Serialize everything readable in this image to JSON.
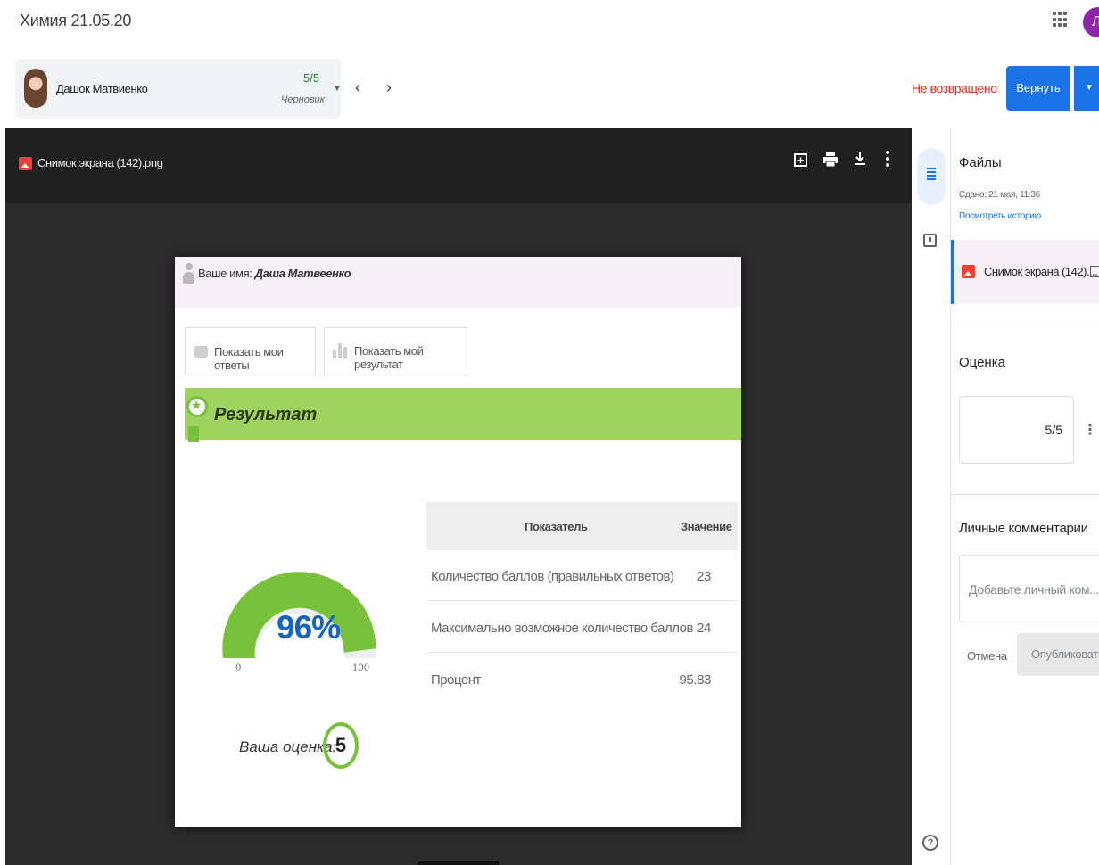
{
  "page": {
    "title": "Химия 21.05.20",
    "account_initial": "Л"
  },
  "student": {
    "name": "Дашок Матвиенко",
    "grade": "5/5",
    "status": "Черновик"
  },
  "actions": {
    "return_status": "Не возвращено",
    "return_label": "Вернуть"
  },
  "viewer": {
    "file_title": "Снимок экрана (142).png"
  },
  "screenshot": {
    "name_label": "Ваше имя:",
    "name_value": "Даша Матвеенко",
    "show_answers": "Показать мои ответы",
    "show_result": "Показать мой результат",
    "result_title": "Результат",
    "gauge": {
      "value": 96,
      "display": "96%",
      "min": "0",
      "max": "100",
      "color": "#78c13a"
    },
    "grade_label": "Ваша оценка:",
    "grade_value": "5",
    "table": {
      "headers": [
        "Показатель",
        "Значение"
      ],
      "rows": [
        {
          "label": "Количество баллов (правильных ответов)",
          "value": "23"
        },
        {
          "label": "Максимально возможное количество баллов",
          "value": "24"
        },
        {
          "label": "Процент",
          "value": "95.83"
        }
      ]
    }
  },
  "panel": {
    "files_title": "Файлы",
    "submitted": "Сдано: 21 мая, 11:36",
    "history_link": "Посмотреть историю",
    "attachment": "Снимок экрана (142)....",
    "grade_title": "Оценка",
    "grade_value": "5/5",
    "comments_title": "Личные комментарии",
    "comment_placeholder": "Добавьте личный ком...",
    "cancel": "Отмена",
    "publish": "Опубликовать"
  },
  "colors": {
    "accent": "#1a73e8",
    "warning": "#d93025",
    "success": "#188038",
    "band": "#9ed35f"
  }
}
